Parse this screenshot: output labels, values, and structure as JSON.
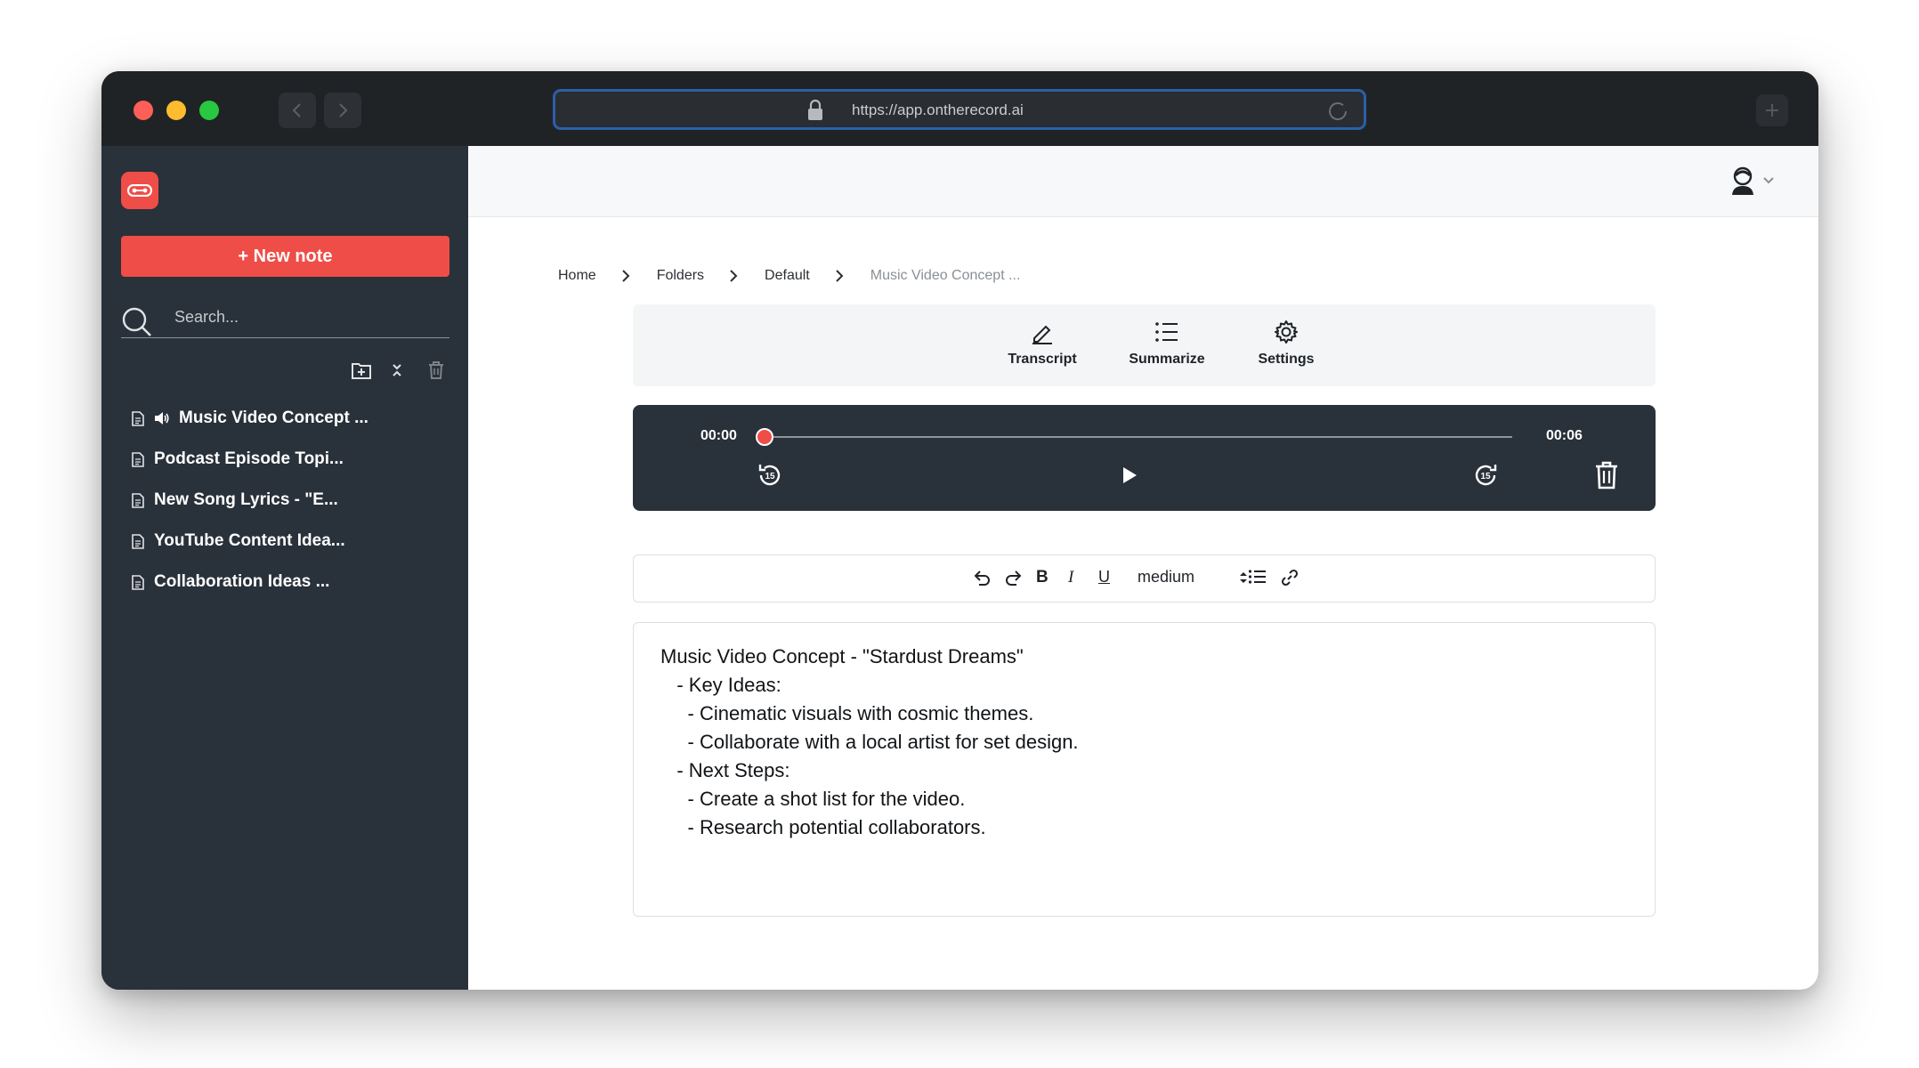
{
  "browser": {
    "url": "https://app.ontherecord.ai"
  },
  "sidebar": {
    "new_note_label": "+ New note",
    "search_placeholder": "Search...",
    "notes": [
      {
        "title": "Music Video Concept ...",
        "has_audio": true
      },
      {
        "title": "Podcast Episode Topi...",
        "has_audio": false
      },
      {
        "title": "New Song Lyrics - \"E...",
        "has_audio": false
      },
      {
        "title": "YouTube Content Idea...",
        "has_audio": false
      },
      {
        "title": "Collaboration Ideas ...",
        "has_audio": false
      }
    ]
  },
  "breadcrumb": {
    "home": "Home",
    "folders": "Folders",
    "default": "Default",
    "current": "Music Video Concept ..."
  },
  "actions": {
    "transcript": "Transcript",
    "summarize": "Summarize",
    "settings": "Settings"
  },
  "player": {
    "current_time": "00:00",
    "duration": "00:06",
    "progress": 0,
    "rewind_seconds": "15",
    "forward_seconds": "15"
  },
  "toolbar": {
    "bold": "B",
    "italic": "I",
    "underline": "U",
    "font_size": "medium"
  },
  "editor": {
    "lines": [
      "Music Video Concept - \"Stardust Dreams\"",
      "   - Key Ideas:",
      "     - Cinematic visuals with cosmic themes.",
      "     - Collaborate with a local artist for set design.",
      "   - Next Steps:",
      "     - Create a shot list for the video.",
      "     - Research potential collaborators."
    ]
  },
  "colors": {
    "accent": "#ef4d48",
    "sidebar_bg": "#29313a",
    "titlebar_bg": "#202326",
    "url_border": "#2c5fa8"
  }
}
